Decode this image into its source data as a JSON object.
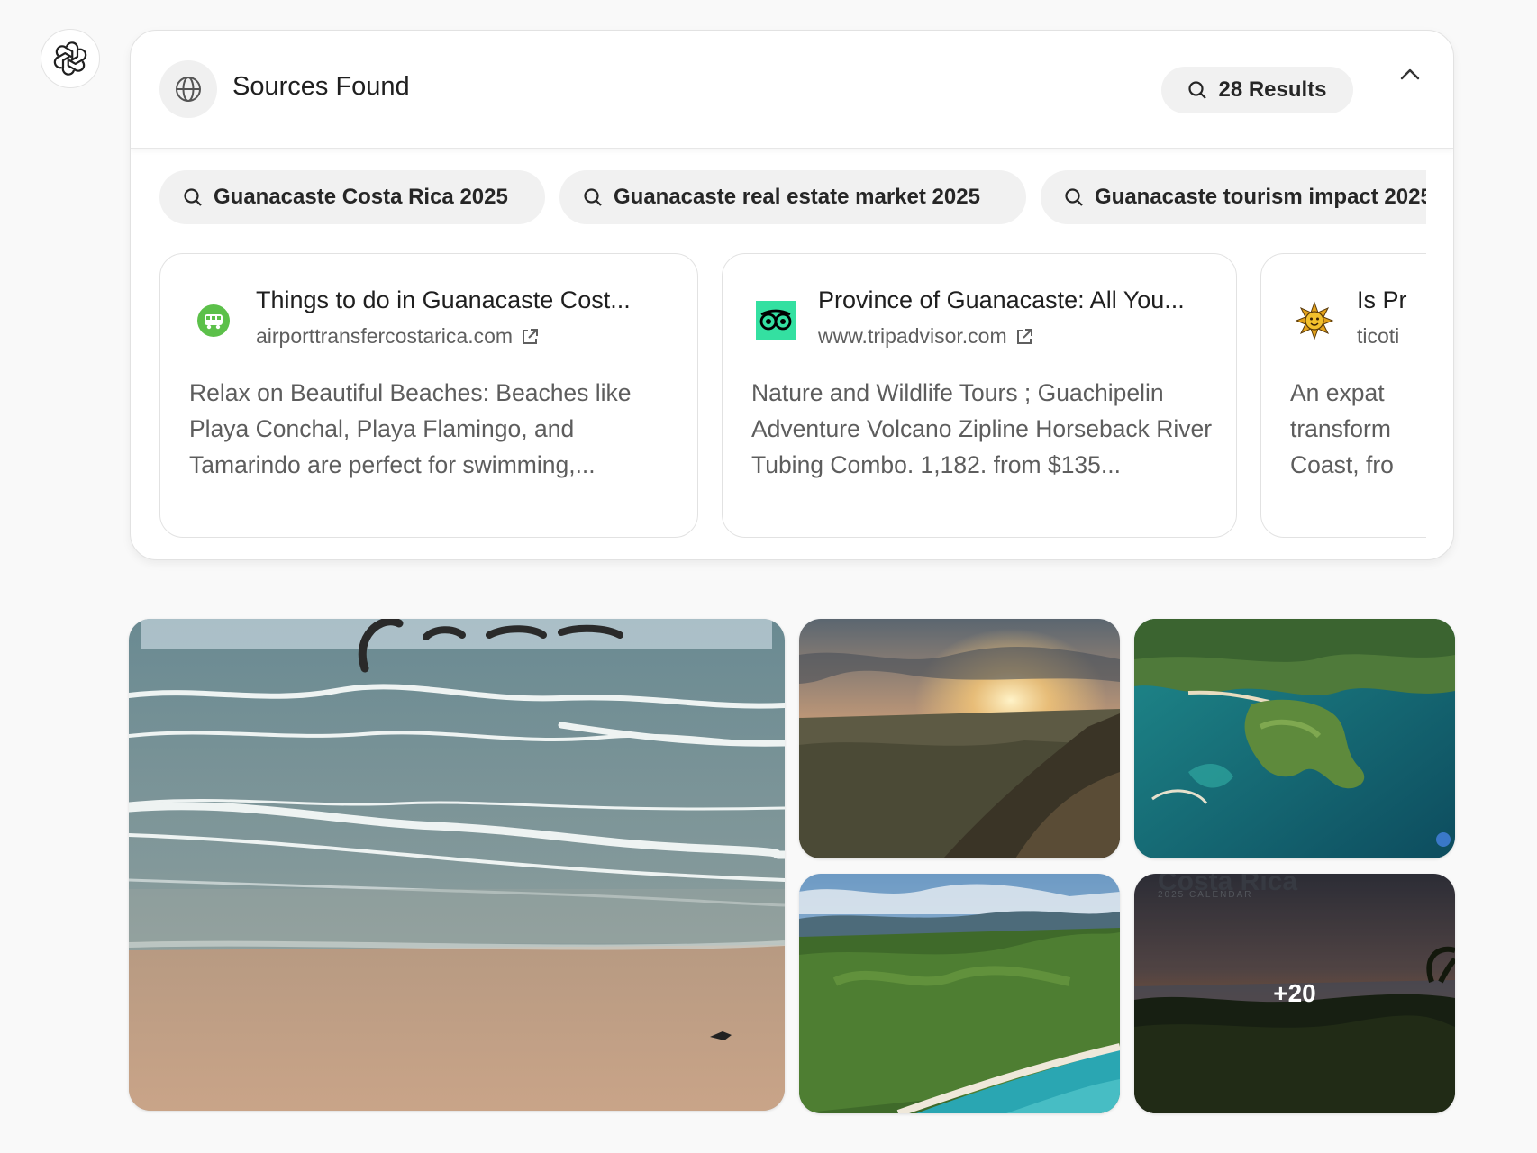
{
  "panel": {
    "title": "Sources Found",
    "results_label": "28 Results"
  },
  "queries": [
    {
      "label": "Guanacaste Costa Rica 2025"
    },
    {
      "label": "Guanacaste real estate market 2025"
    },
    {
      "label": "Guanacaste tourism impact 2025"
    }
  ],
  "sources": [
    {
      "title": "Things to do in Guanacaste Cost...",
      "domain": "airporttransfercostarica.com",
      "snippet": "Relax on Beautiful Beaches: Beaches like Playa Conchal, Playa Flamingo, and Tamarindo are perfect for swimming,...",
      "favicon": "shuttle-van-icon",
      "favicon_color": "#5cc04a"
    },
    {
      "title": "Province of Guanacaste: All You...",
      "domain": "www.tripadvisor.com",
      "snippet": "Nature and Wildlife Tours ; Guachipelin Adventure Volcano Zipline Horseback River Tubing Combo. 1,182. from $135...",
      "favicon": "owl-eyes-icon",
      "favicon_color": "#34e0a1"
    },
    {
      "title": "Is Pr",
      "domain": "ticoti",
      "snippet": "An expat transform Coast, fro",
      "favicon": "sun-face-icon",
      "favicon_color": "#e3a21a"
    }
  ],
  "gallery": {
    "more_label": "+20",
    "photo_overlay_text": [
      "Costa Rica",
      "2025 CALENDAR"
    ]
  }
}
